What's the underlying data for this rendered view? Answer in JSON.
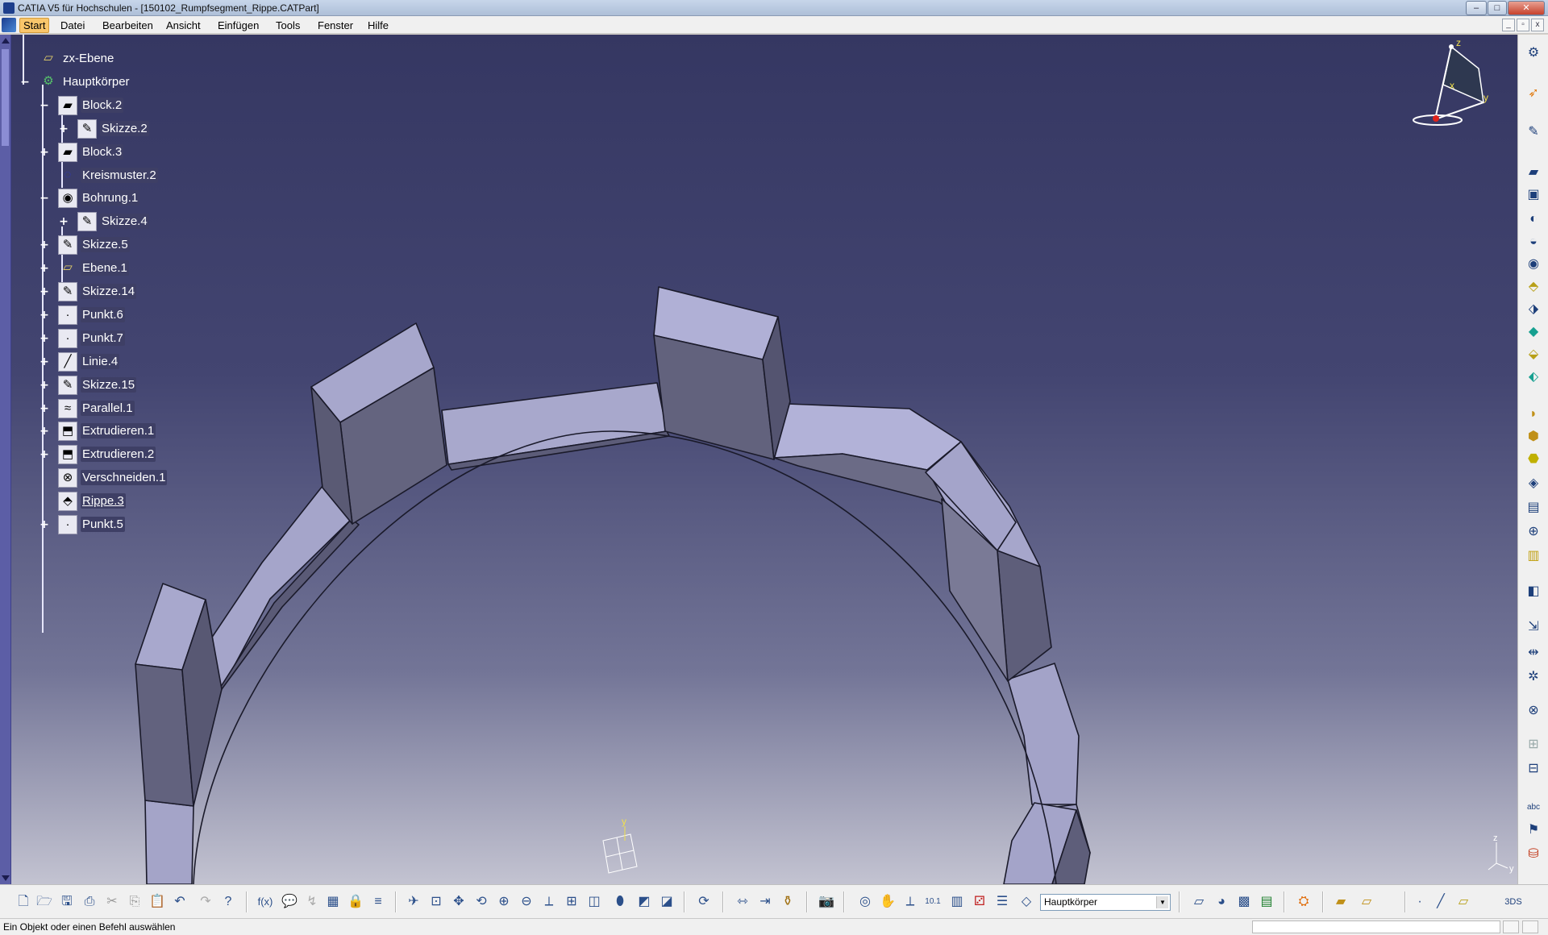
{
  "window": {
    "title": "CATIA V5 für Hochschulen - [150102_Rumpfsegment_Rippe.CATPart]",
    "controls": [
      "–",
      "□",
      "✕"
    ]
  },
  "menu": {
    "items": [
      "Start",
      "Datei",
      "Bearbeiten",
      "Ansicht",
      "Einfügen",
      "Tools",
      "Fenster",
      "Hilfe"
    ],
    "active": "Start",
    "mdi_controls": [
      "_",
      "▫",
      "x"
    ]
  },
  "tree": {
    "nodes": [
      {
        "label": "zx-Ebene",
        "icon": "plane-icon",
        "expander": ""
      },
      {
        "label": "Hauptkörper",
        "icon": "body-icon",
        "expander": "−"
      },
      {
        "label": "Block.2",
        "icon": "pad-icon",
        "expander": "−"
      },
      {
        "label": "Skizze.2",
        "icon": "sketch-icon",
        "expander": "+"
      },
      {
        "label": "Block.3",
        "icon": "pad-icon",
        "expander": "+"
      },
      {
        "label": "Kreismuster.2",
        "icon": "circular-pattern-icon",
        "expander": ""
      },
      {
        "label": "Bohrung.1",
        "icon": "hole-icon",
        "expander": "−"
      },
      {
        "label": "Skizze.4",
        "icon": "sketch-icon",
        "expander": "+"
      },
      {
        "label": "Skizze.5",
        "icon": "sketch-icon",
        "expander": "+"
      },
      {
        "label": "Ebene.1",
        "icon": "plane-icon",
        "expander": "+"
      },
      {
        "label": "Skizze.14",
        "icon": "sketch-icon",
        "expander": "+"
      },
      {
        "label": "Punkt.6",
        "icon": "point-icon",
        "expander": "+"
      },
      {
        "label": "Punkt.7",
        "icon": "point-icon",
        "expander": "+"
      },
      {
        "label": "Linie.4",
        "icon": "line-icon",
        "expander": "+"
      },
      {
        "label": "Skizze.15",
        "icon": "sketch-icon",
        "expander": "+"
      },
      {
        "label": "Parallel.1",
        "icon": "parallel-curve-icon",
        "expander": "+"
      },
      {
        "label": "Extrudieren.1",
        "icon": "extrude-icon",
        "expander": "+"
      },
      {
        "label": "Extrudieren.2",
        "icon": "extrude-icon",
        "expander": "+"
      },
      {
        "label": "Verschneiden.1",
        "icon": "intersect-icon",
        "expander": ""
      },
      {
        "label": "Rippe.3",
        "icon": "rib-icon",
        "expander": ""
      },
      {
        "label": "Punkt.5",
        "icon": "point-icon",
        "expander": "+"
      }
    ]
  },
  "compass": {
    "x": "x",
    "y": "y",
    "z": "z"
  },
  "axis_small": {
    "y": "y"
  },
  "axis_corner": {
    "z": "z",
    "y": "y"
  },
  "bottom_toolbar": {
    "body_select": "Hauptkörper"
  },
  "status": {
    "message": "Ein Objekt oder einen Befehl auswählen"
  },
  "colors": {
    "viewport_top": "#353762",
    "viewport_bottom": "#c3c3d1",
    "part_light": "#aaaad0",
    "part_dark": "#62627e"
  }
}
